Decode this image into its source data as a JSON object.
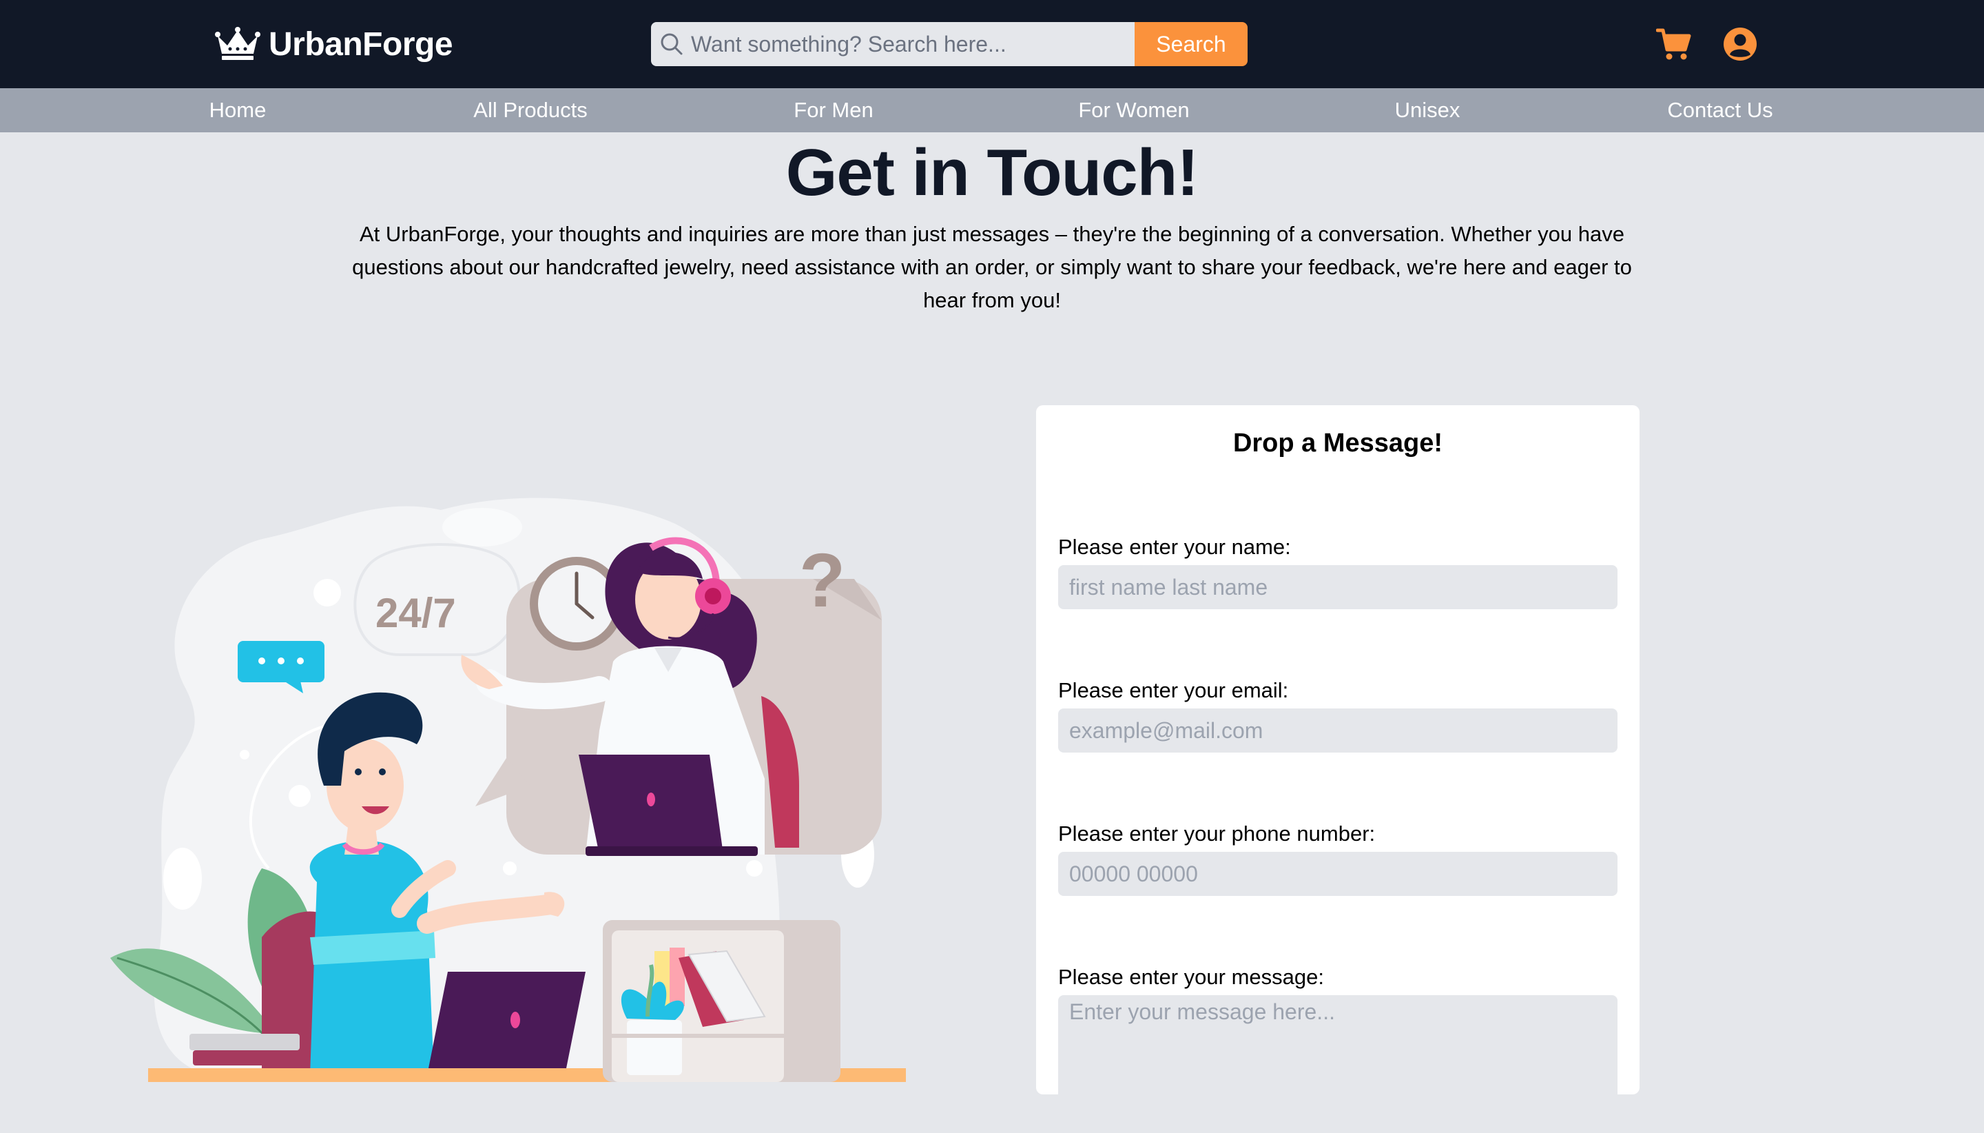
{
  "header": {
    "brand": "UrbanForge",
    "search_placeholder": "Want something? Search here...",
    "search_button": "Search",
    "icons": [
      "crown-icon",
      "search-icon",
      "cart-icon",
      "user-icon"
    ],
    "accent_color": "#fb923c",
    "background_color": "#111827"
  },
  "nav": {
    "items": [
      "Home",
      "All Products",
      "For Men",
      "For Women",
      "Unisex",
      "Contact Us"
    ],
    "background_color": "#9ca3af"
  },
  "hero": {
    "title": "Get in Touch!",
    "text": "At UrbanForge, your thoughts and inquiries are more than just messages – they're the beginning of a conversation. Whether you have questions about our handcrafted jewelry, need assistance with an order, or simply want to share your feedback, we're here and eager to hear from you!"
  },
  "illustration": {
    "badge_text": "24/7",
    "question_mark": "?"
  },
  "form": {
    "title": "Drop a Message!",
    "name_label": "Please enter your name:",
    "name_placeholder": "first name last name",
    "email_label": "Please enter your email:",
    "email_placeholder": "example@mail.com",
    "phone_label": "Please enter your phone number:",
    "phone_placeholder": "00000 00000",
    "message_label": "Please enter your message:",
    "message_placeholder": "Enter your message here..."
  }
}
